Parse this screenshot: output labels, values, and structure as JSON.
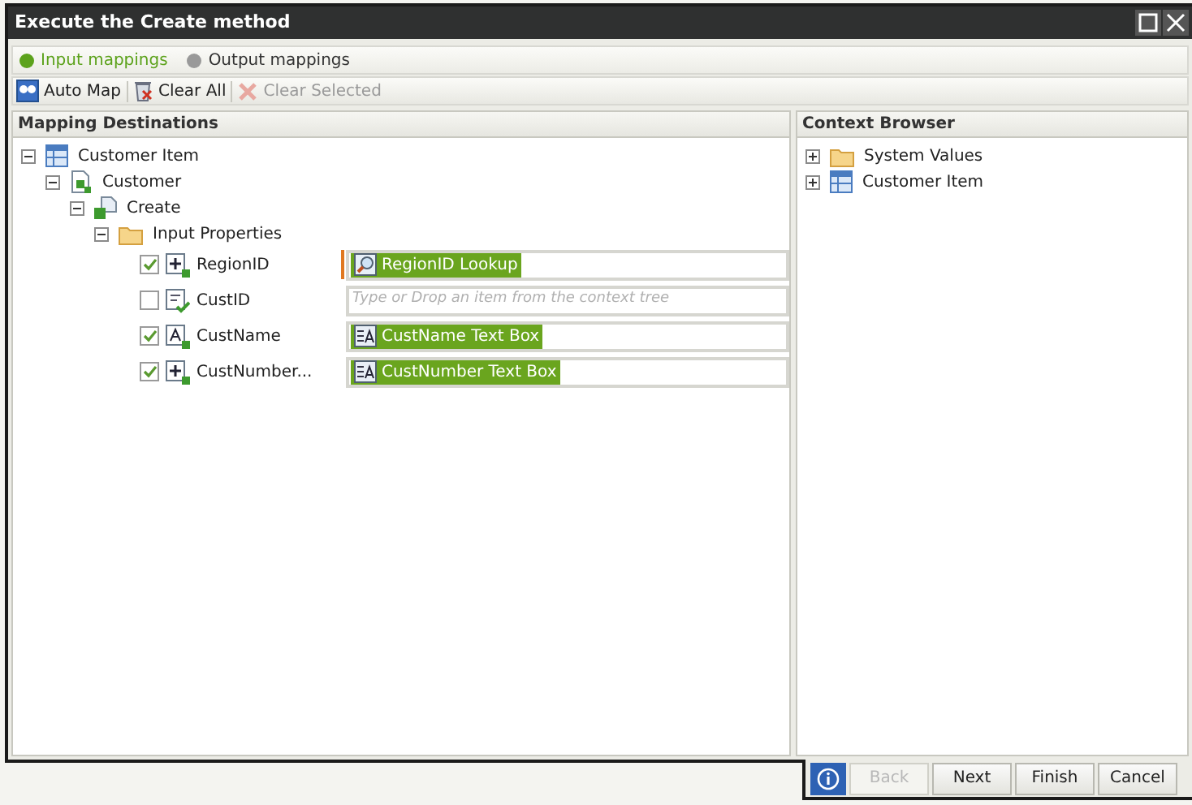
{
  "window": {
    "title": "Execute the Create method"
  },
  "tabs": [
    {
      "label": "Input mappings",
      "selected": true
    },
    {
      "label": "Output mappings",
      "selected": false
    }
  ],
  "toolbar": [
    {
      "label": "Auto Map",
      "kind": "automap",
      "disabled": false
    },
    {
      "label": "Clear All",
      "kind": "clear",
      "disabled": false
    },
    {
      "label": "Clear Selected",
      "kind": "cross",
      "disabled": true
    }
  ],
  "mapping_destinations": {
    "title": "Mapping Destinations",
    "tree": [
      {
        "kind": "table",
        "label": "Customer Item",
        "expanded": true,
        "children": [
          {
            "kind": "object",
            "label": "Customer",
            "expanded": true,
            "children": [
              {
                "kind": "method",
                "label": "Create",
                "expanded": true,
                "children": [
                  {
                    "kind": "folder",
                    "label": "Input Properties",
                    "expanded": true,
                    "children": [
                      {
                        "kind": "number",
                        "label": "RegionID",
                        "checked": true,
                        "focused": true,
                        "mapped": {
                          "kind": "lookup",
                          "label": "RegionID Lookup"
                        }
                      },
                      {
                        "kind": "key",
                        "label": "CustID",
                        "checked": false,
                        "focused": false,
                        "placeholder": "Type or Drop an item from the context tree"
                      },
                      {
                        "kind": "text",
                        "label": "CustName",
                        "checked": true,
                        "focused": false,
                        "mapped": {
                          "kind": "textbox",
                          "label": "CustName Text Box"
                        }
                      },
                      {
                        "kind": "number",
                        "label": "CustNumber...",
                        "checked": true,
                        "focused": false,
                        "mapped": {
                          "kind": "textbox",
                          "label": "CustNumber Text Box"
                        }
                      }
                    ]
                  }
                ]
              }
            ]
          }
        ]
      }
    ]
  },
  "context_browser": {
    "title": "Context Browser",
    "tree": [
      {
        "kind": "folder",
        "label": "System Values",
        "expanded": false
      },
      {
        "kind": "table",
        "label": "Customer Item",
        "expanded": false
      }
    ]
  },
  "footer_buttons": [
    {
      "kind": "info",
      "disabled": false
    },
    {
      "kind": "text",
      "label": "Back",
      "disabled": true
    },
    {
      "kind": "text",
      "label": "Next",
      "disabled": false
    },
    {
      "kind": "text",
      "label": "Finish",
      "disabled": false
    },
    {
      "kind": "text",
      "label": "Cancel",
      "disabled": false
    }
  ]
}
